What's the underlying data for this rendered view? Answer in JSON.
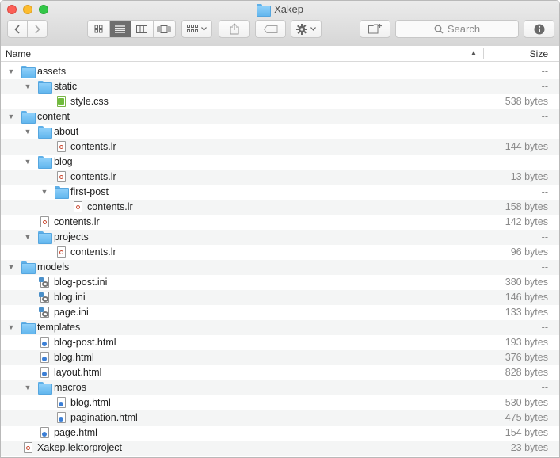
{
  "window": {
    "title": "Xakep"
  },
  "toolbar": {
    "search_placeholder": "Search",
    "icons": {
      "back": "chevron-left-icon",
      "forward": "chevron-right-icon",
      "view_icons": "grid-icon",
      "view_list": "list-icon",
      "view_columns": "columns-icon",
      "view_gallery": "coverflow-icon",
      "arrange": "arrange-icon",
      "share": "share-icon",
      "tags": "tag-icon",
      "action": "gear-icon",
      "new_folder": "new-folder-icon",
      "search": "search-icon",
      "info": "info-icon"
    }
  },
  "columns": {
    "name": "Name",
    "size": "Size"
  },
  "rows": [
    {
      "name": "assets",
      "type": "folder",
      "level": 0,
      "size": "--"
    },
    {
      "name": "static",
      "type": "folder",
      "level": 1,
      "size": "--"
    },
    {
      "name": "style.css",
      "type": "css",
      "level": 2,
      "size": "538 bytes"
    },
    {
      "name": "content",
      "type": "folder",
      "level": 0,
      "size": "--"
    },
    {
      "name": "about",
      "type": "folder",
      "level": 1,
      "size": "--"
    },
    {
      "name": "contents.lr",
      "type": "lr",
      "level": 2,
      "size": "144 bytes"
    },
    {
      "name": "blog",
      "type": "folder",
      "level": 1,
      "size": "--"
    },
    {
      "name": "contents.lr",
      "type": "lr",
      "level": 2,
      "size": "13 bytes"
    },
    {
      "name": "first-post",
      "type": "folder",
      "level": 2,
      "size": "--"
    },
    {
      "name": "contents.lr",
      "type": "lr",
      "level": 3,
      "size": "158 bytes"
    },
    {
      "name": "contents.lr",
      "type": "lr",
      "level": 1,
      "size": "142 bytes"
    },
    {
      "name": "projects",
      "type": "folder",
      "level": 1,
      "size": "--"
    },
    {
      "name": "contents.lr",
      "type": "lr",
      "level": 2,
      "size": "96 bytes"
    },
    {
      "name": "models",
      "type": "folder",
      "level": 0,
      "size": "--"
    },
    {
      "name": "blog-post.ini",
      "type": "ini",
      "level": 1,
      "size": "380 bytes"
    },
    {
      "name": "blog.ini",
      "type": "ini",
      "level": 1,
      "size": "146 bytes"
    },
    {
      "name": "page.ini",
      "type": "ini",
      "level": 1,
      "size": "133 bytes"
    },
    {
      "name": "templates",
      "type": "folder",
      "level": 0,
      "size": "--"
    },
    {
      "name": "blog-post.html",
      "type": "html",
      "level": 1,
      "size": "193 bytes"
    },
    {
      "name": "blog.html",
      "type": "html",
      "level": 1,
      "size": "376 bytes"
    },
    {
      "name": "layout.html",
      "type": "html",
      "level": 1,
      "size": "828 bytes"
    },
    {
      "name": "macros",
      "type": "folder",
      "level": 1,
      "size": "--"
    },
    {
      "name": "blog.html",
      "type": "html",
      "level": 2,
      "size": "530 bytes"
    },
    {
      "name": "pagination.html",
      "type": "html",
      "level": 2,
      "size": "475 bytes"
    },
    {
      "name": "page.html",
      "type": "html",
      "level": 1,
      "size": "154 bytes"
    },
    {
      "name": "Xakep.lektorproject",
      "type": "lr",
      "level": 0,
      "size": "23 bytes"
    }
  ]
}
